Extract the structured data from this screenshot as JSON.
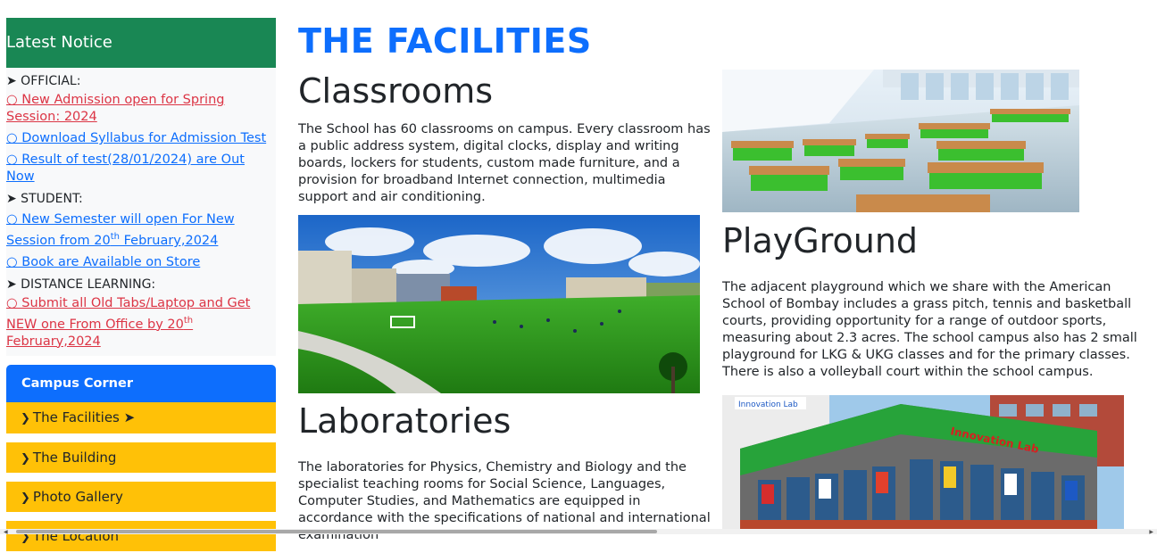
{
  "sidebar": {
    "notice_title": "Latest Notice",
    "official_label": "➤ OFFICIAL:",
    "official_links": [
      {
        "text": "○ New Admission open for Spring Session: 2024"
      },
      {
        "text": "○ Download Syllabus for Admission Test"
      },
      {
        "text": "○ Result of test(28/01/2024) are Out Now"
      }
    ],
    "student_label": "➤ STUDENT:",
    "student_link_1": {
      "pre": "○ New Semester will open For New Session from 20",
      "sup": "th",
      "post": " February,2024"
    },
    "student_link_2": "○ Book are Available on Store",
    "distance_label": "➤ DISTANCE LEARNING:",
    "distance_link": {
      "pre": "○ Submit all Old Tabs/Laptop and Get NEW one From Office by 20",
      "sup": "th",
      "post": " February,2024"
    },
    "corner_title": "Campus Corner",
    "corner_items": [
      {
        "label": "The Facilities ➤"
      },
      {
        "label": "The Building"
      },
      {
        "label": "Photo Gallery"
      },
      {
        "label": "The Location"
      }
    ],
    "chevron": "❯"
  },
  "main": {
    "title": "THE FACILITIES",
    "classrooms": {
      "heading": "Classrooms",
      "text": "The School has 60 classrooms on campus. Every classroom has a public address system, digital clocks, display and writing boards, lockers for students, custom made furniture, and a provision for broadband Internet connection, multimedia support and air conditioning."
    },
    "playground": {
      "heading": "PlayGround",
      "text": "The adjacent playground which we share with the American School of Bombay includes a grass pitch, tennis and basketball courts, providing opportunity for a range of outdoor sports, measuring about 2.3 acres. The school campus also has 2 small playground for LKG & UKG classes and for the primary classes. There is also a volleyball court within the school campus."
    },
    "laboratories": {
      "heading": "Laboratories",
      "text": "The laboratories for Physics, Chemistry and Biology and the specialist teaching rooms for Social Science, Languages, Computer Studies, and Mathematics are equipped in accordance with the specifications of national and international examination"
    },
    "lab_sign": "Innovation Lab",
    "lab_sign_small": "Innovation Lab"
  },
  "colors": {
    "notice_head": "#198754",
    "corner_head": "#0d6efd",
    "corner_btn": "#ffc107",
    "title_blue": "#0d6efd",
    "link_red": "#dc3545",
    "link_blue": "#0d6efd"
  }
}
